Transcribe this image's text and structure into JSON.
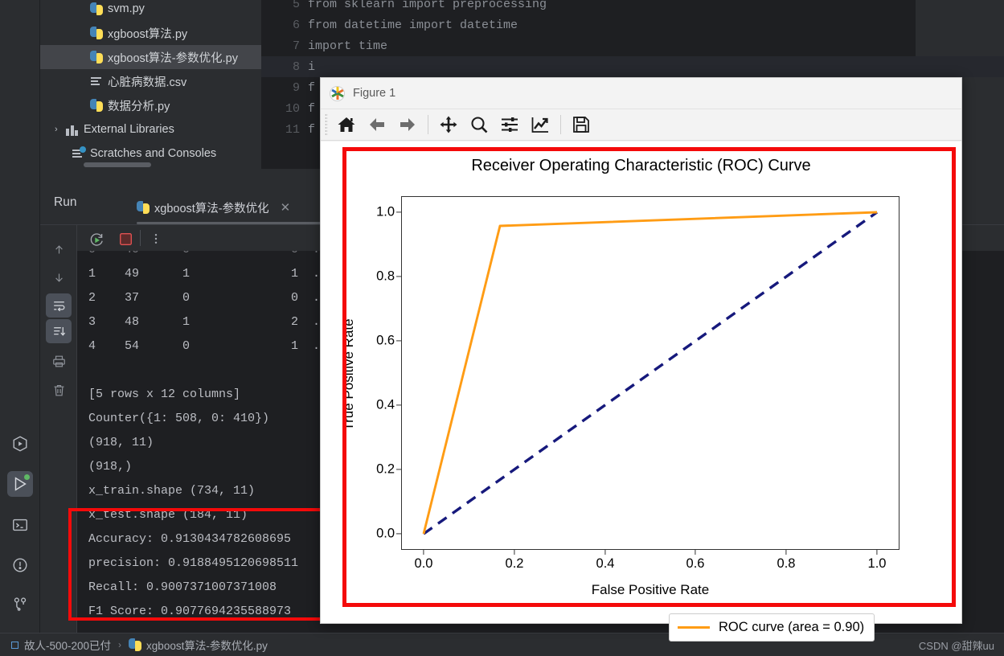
{
  "ide": {
    "project_tree": [
      {
        "label": "svm.py",
        "icon": "python-file-icon",
        "indent": 62,
        "selected": false
      },
      {
        "label": "xgboost算法.py",
        "icon": "python-file-icon",
        "indent": 62,
        "selected": false
      },
      {
        "label": "xgboost算法-参数优化.py",
        "icon": "python-file-icon",
        "indent": 62,
        "selected": true
      },
      {
        "label": "心脏病数据.csv",
        "icon": "csv-file-icon",
        "indent": 62,
        "selected": false
      },
      {
        "label": "数据分析.py",
        "icon": "python-file-icon",
        "indent": 62,
        "selected": false
      },
      {
        "label": "External Libraries",
        "icon": "library-icon",
        "indent": 18,
        "selected": false,
        "chevron": "›"
      },
      {
        "label": "Scratches and Consoles",
        "icon": "scratches-icon",
        "indent": 40,
        "selected": false
      }
    ],
    "editor_lines": [
      {
        "num": "5",
        "text": "from sklearn import preprocessing",
        "highlight": false
      },
      {
        "num": "6",
        "text": "from datetime import datetime",
        "highlight": false
      },
      {
        "num": "7",
        "text": "import time",
        "highlight": false
      },
      {
        "num": "8",
        "text": "i",
        "highlight": true
      },
      {
        "num": "9",
        "text": "f",
        "highlight": false
      },
      {
        "num": "10",
        "text": "f",
        "highlight": false
      },
      {
        "num": "11",
        "text": "f",
        "highlight": false
      }
    ],
    "run_panel": {
      "title": "Run",
      "tab_label": "xgboost算法-参数优化",
      "tab_close": "✕",
      "console_lines": [
        "1    49      1              1  .",
        "2    37      0              0  .",
        "3    48      1              2  .",
        "4    54      0              1  .",
        "",
        "[5 rows x 12 columns]",
        "Counter({1: 508, 0: 410})",
        "(918, 11)",
        "(918,)",
        "x_train.shape (734, 11)",
        "x_test.shape (184, 11)",
        "Accuracy: 0.9130434782608695",
        "precision: 0.9188495120698511",
        "Recall: 0.9007371007371008",
        "F1 Score: 0.9077694235588973"
      ]
    },
    "statusbar": {
      "project_name": "故人-500-200已付",
      "separator": "›",
      "file_name": "xgboost算法-参数优化.py",
      "watermark": "CSDN @甜辣uu"
    }
  },
  "figure_window": {
    "title": "Figure 1",
    "app_icon": "matplotlib-icon",
    "window_buttons": [
      {
        "name": "minimize-button",
        "glyph": "—"
      },
      {
        "name": "maximize-button",
        "glyph": "▢"
      },
      {
        "name": "close-button",
        "glyph": "✕"
      }
    ],
    "toolbar_buttons": [
      {
        "name": "home-icon",
        "tooltip": "Home"
      },
      {
        "name": "back-arrow-icon",
        "tooltip": "Back"
      },
      {
        "name": "forward-arrow-icon",
        "tooltip": "Forward"
      },
      {
        "name": "pan-move-icon",
        "tooltip": "Pan"
      },
      {
        "name": "zoom-magnifier-icon",
        "tooltip": "Zoom to rectangle"
      },
      {
        "name": "configure-subplots-icon",
        "tooltip": "Configure subplots"
      },
      {
        "name": "edit-axis-icon",
        "tooltip": "Edit axis"
      },
      {
        "name": "save-floppy-icon",
        "tooltip": "Save figure"
      }
    ]
  },
  "annotations": {
    "highlight_color": "#f40a0a"
  },
  "chart_data": {
    "type": "line",
    "title": "Receiver Operating Characteristic (ROC) Curve",
    "xlabel": "False Positive Rate",
    "ylabel": "True Positive Rate",
    "xlim": [
      -0.05,
      1.05
    ],
    "ylim": [
      -0.05,
      1.05
    ],
    "xticks": [
      "0.0",
      "0.2",
      "0.4",
      "0.6",
      "0.8",
      "1.0"
    ],
    "xtick_values": [
      0.0,
      0.2,
      0.4,
      0.6,
      0.8,
      1.0
    ],
    "yticks": [
      "0.0",
      "0.2",
      "0.4",
      "0.6",
      "0.8",
      "1.0"
    ],
    "ytick_values": [
      0.0,
      0.2,
      0.4,
      0.6,
      0.8,
      1.0
    ],
    "grid": false,
    "legend_position": "lower right",
    "series": [
      {
        "name": "ROC curve (area = 0.90)",
        "color": "#ff9c14",
        "linestyle": "solid",
        "linewidth": 2.8,
        "x": [
          0.0,
          0.168,
          1.0
        ],
        "y": [
          0.0,
          0.958,
          1.0
        ]
      },
      {
        "name": "chance-diagonal",
        "color": "#16197c",
        "linestyle": "dashed",
        "linewidth": 3.2,
        "x": [
          0.0,
          1.0
        ],
        "y": [
          0.0,
          1.0
        ]
      }
    ],
    "legend_entries": [
      {
        "label": "ROC curve (area = 0.90)",
        "color": "#ff9c14"
      }
    ],
    "auc": 0.9
  }
}
